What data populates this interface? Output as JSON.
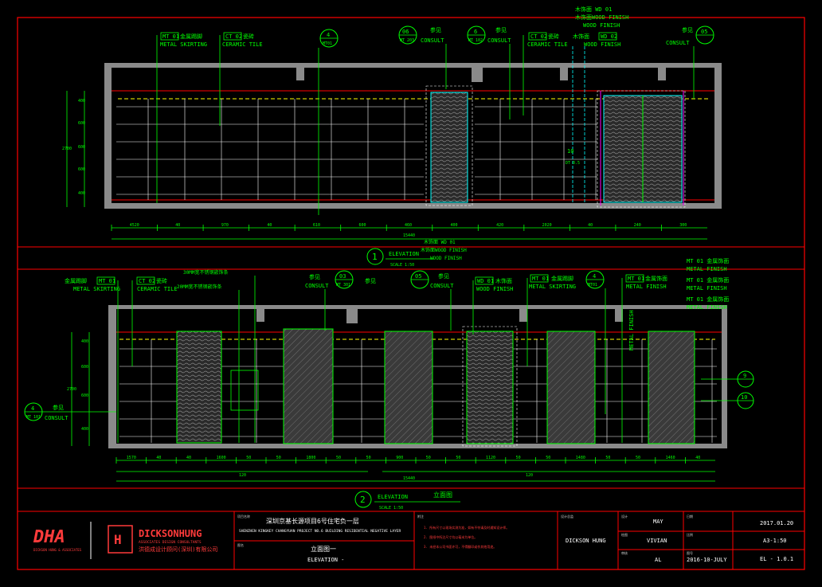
{
  "elevation1": {
    "callouts": [
      {
        "code": "MT 01",
        "cn": "金属踢脚",
        "en": "METAL SKIRTING"
      },
      {
        "code": "CT 02",
        "cn": "瓷砖",
        "en": "CERAMIC TILE"
      },
      {
        "code": "4",
        "sub": "MT01"
      },
      {
        "code": "06",
        "sub": "MT 203",
        "cn": "参见",
        "en": "CONSULT"
      },
      {
        "code": "6",
        "sub": "MT 102",
        "cn": "参见",
        "en": "CONSULT"
      },
      {
        "code": "CT 02",
        "cn": "瓷砖",
        "en": "CERAMIC TILE"
      },
      {
        "code": "WD 01",
        "cn": "木饰面",
        "en": "WOOD FINISH"
      },
      {
        "code": "WD 02",
        "cn": "木饰面",
        "en": "WOOD FINISH"
      },
      {
        "code": "05",
        "cn": "参见",
        "en": "CONSULT"
      }
    ],
    "top_note": {
      "line1": "木饰面 WD 01",
      "line2": "木饰面WOOD FINISH",
      "line3": "WOOD FINISH"
    },
    "left_dims": [
      "400",
      "600",
      "600",
      "600",
      "400"
    ],
    "left_total": "2700",
    "bottom_dims": [
      "4520",
      "40",
      "970",
      "40",
      "610",
      "600",
      "460",
      "400",
      "420",
      "2020",
      "40",
      "240",
      "300"
    ],
    "bottom_total": "15440",
    "tag": "10",
    "tag_sub": "DT 0.5",
    "title_num": "1",
    "title": "ELEVATION",
    "scale": "SCALE   1:50"
  },
  "elevation2": {
    "callouts": [
      {
        "code": "MT 01",
        "cn": "金属踢脚",
        "en": "METAL SKIRTING"
      },
      {
        "code": "CT 02",
        "cn": "瓷砖",
        "en": "CERAMIC TILE"
      },
      {
        "code": "03",
        "sub": "MT 301",
        "cn": "参见",
        "en": "CONSULT"
      },
      {
        "code": "05",
        "cn": "参见",
        "en": "CONSULT"
      },
      {
        "code": "WD 01",
        "cn": "木饰面",
        "en": "WOOD FINISH"
      },
      {
        "code": "MT 01",
        "cn": "金属踢脚",
        "en": "METAL SKIRTING"
      },
      {
        "code": "4",
        "sub": "MT01"
      },
      {
        "code": "MT 01",
        "cn": "金属饰面",
        "en": "METAL FINISH"
      }
    ],
    "notes": {
      "mt30": "30MM宽不锈钢嵌饰条",
      "mt20": "20MM宽不锈钢嵌饰条",
      "consult_cn": "参见",
      "consult_en": "CONSULT",
      "top1": "木饰面 WD 01",
      "top2": "木饰面WOOD FINISH",
      "top3": "WOOD FINISH",
      "right1": "MT 01 金属饰面",
      "right2": "METAL FINISH",
      "right3": "MT 01 金属饰面",
      "right4": "METAL FINISH",
      "right5": "MT 01 金属饰面",
      "right6": "METAL FINISH",
      "vertical": "METAL FINISH",
      "left_tag": "4",
      "left_tag_sub": "MT 101",
      "side_tag1": "9",
      "side_tag2": "10"
    },
    "left_dims": [
      "400",
      "600",
      "600",
      "400"
    ],
    "left_total": "2700",
    "bottom_dims": [
      "1570",
      "40",
      "40",
      "1600",
      "50",
      "50",
      "1800",
      "50",
      "50",
      "900",
      "50",
      "50",
      "1120",
      "50",
      "50",
      "1480",
      "50",
      "50",
      "1460",
      "40"
    ],
    "bottom_total": "15440",
    "sub_total_left": "120",
    "sub_total_right": "120",
    "title_num": "2",
    "title": "ELEVATION",
    "title_cn": "立面图",
    "scale": "SCALE   1:50"
  },
  "title_block": {
    "logo1": "DHA",
    "logo1_sub": "DICKSON HUNG & ASSOCIATES",
    "logo2": "DICKSONHUNG",
    "logo2_sub": "ASSOCIATES DESIGN CONSULTANTS",
    "logo2_cn": "洪德成设计顾问(深圳)有限公司",
    "project_label": "项目名称",
    "project_cn": "深圳京基长源项目6号住宅负一层",
    "project_en": "SHENZHEN KINGKEY CHANGYUAN PROJECT NO.6 BUILDING RESIDENTIAL NEGATIVE LAYER",
    "drawing_label": "图名",
    "drawing_cn": "立面图一",
    "drawing_en": "ELEVATION -",
    "notes_label": "附注",
    "note1": "1. 所有尺寸以现场实测为准，如有不符请及时通知设计师。",
    "note2": "2. 图纸中所注尺寸均以毫米为单位。",
    "note3": "3. 未经本公司书面许可，不得翻印或作其他用途。",
    "director_label": "设计总监",
    "director": "DICKSON HUNG",
    "designer_label": "设计",
    "designer": "MAY",
    "drawn_label": "绘图",
    "drawn": "VIVIAN",
    "checked_label": "审核",
    "checked": "AL",
    "date_label": "日期",
    "date": "2016-10-JULY",
    "date2": "2017.01.20",
    "scale_label": "比例",
    "scale": "A3-1:50",
    "sheet_label": "图号",
    "sheet": "EL - 1.0.1"
  },
  "colors": {
    "border": "#ff0000",
    "frame": "#ffffff",
    "callout": "#00ff00",
    "dimension": "#00ff00",
    "grid": "#ffffff",
    "fill_dark": "#3a3a3a",
    "cyan": "#00ffff",
    "magenta": "#ff00ff",
    "yellow": "#ffff00"
  }
}
